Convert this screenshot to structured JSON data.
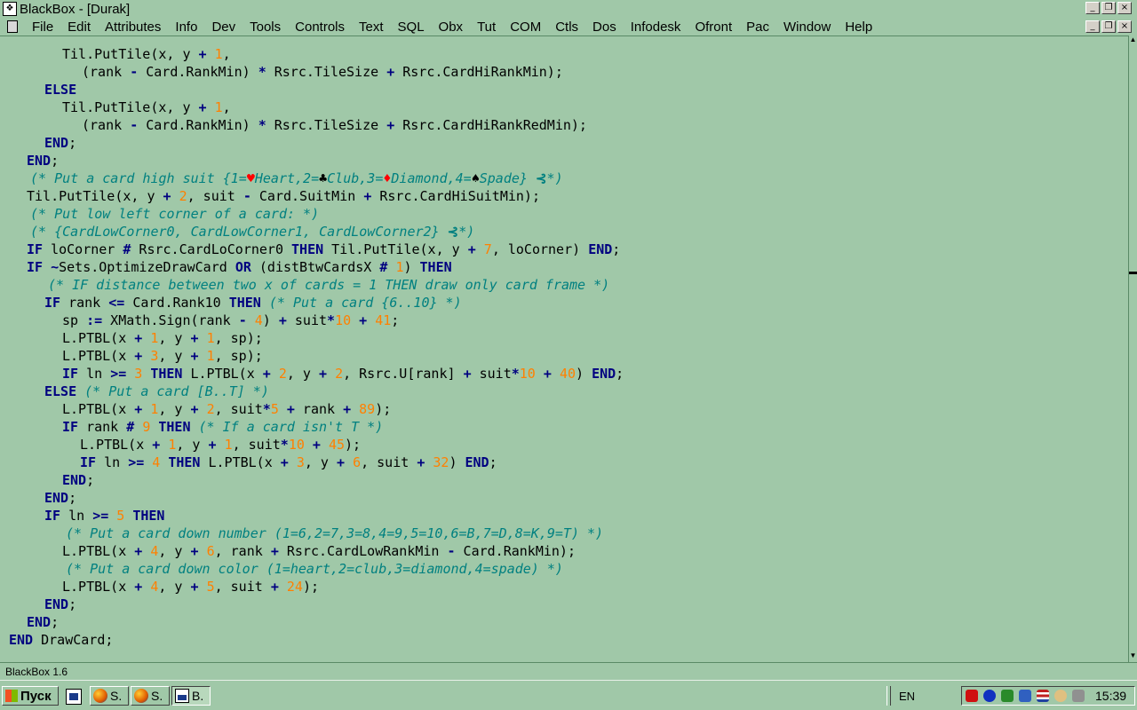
{
  "window": {
    "title": "BlackBox - [Durak]",
    "app_icon_glyph": "❖",
    "outer_controls": [
      "_",
      "❐",
      "×"
    ],
    "doc_controls": [
      "_",
      "❐",
      "×"
    ]
  },
  "menu": [
    "File",
    "Edit",
    "Attributes",
    "Info",
    "Dev",
    "Tools",
    "Controls",
    "Text",
    "SQL",
    "Obx",
    "Tut",
    "COM",
    "Ctls",
    "Dos",
    "Infodesk",
    "Ofront",
    "Pac",
    "Window",
    "Help"
  ],
  "code_lines": [
    {
      "indent": 70,
      "tokens": [
        {
          "t": "Til.PutTile(x, y "
        },
        {
          "t": "+",
          "c": "kw"
        },
        {
          "t": " "
        },
        {
          "t": "1",
          "c": "num"
        },
        {
          "t": ","
        }
      ]
    },
    {
      "indent": 92,
      "tokens": [
        {
          "t": "(rank "
        },
        {
          "t": "-",
          "c": "kw"
        },
        {
          "t": " Card.RankMin) "
        },
        {
          "t": "*",
          "c": "kw"
        },
        {
          "t": " Rsrc.TileSize "
        },
        {
          "t": "+",
          "c": "kw"
        },
        {
          "t": " Rsrc.CardHiRankMin);"
        }
      ]
    },
    {
      "indent": 50,
      "tokens": [
        {
          "t": "ELSE",
          "c": "kw"
        }
      ]
    },
    {
      "indent": 70,
      "tokens": [
        {
          "t": "Til.PutTile(x, y "
        },
        {
          "t": "+",
          "c": "kw"
        },
        {
          "t": " "
        },
        {
          "t": "1",
          "c": "num"
        },
        {
          "t": ","
        }
      ]
    },
    {
      "indent": 92,
      "tokens": [
        {
          "t": "(rank "
        },
        {
          "t": "-",
          "c": "kw"
        },
        {
          "t": " Card.RankMin) "
        },
        {
          "t": "*",
          "c": "kw"
        },
        {
          "t": " Rsrc.TileSize "
        },
        {
          "t": "+",
          "c": "kw"
        },
        {
          "t": " Rsrc.CardHiRankRedMin);"
        }
      ]
    },
    {
      "indent": 50,
      "tokens": [
        {
          "t": "END",
          "c": "kw"
        },
        {
          "t": ";"
        }
      ]
    },
    {
      "indent": 30,
      "tokens": [
        {
          "t": "END",
          "c": "kw"
        },
        {
          "t": ";"
        }
      ]
    },
    {
      "indent": 34,
      "tokens": [
        {
          "t": "(* Put a card high suit {1=",
          "c": "cm"
        },
        {
          "t": "♥",
          "c": "red"
        },
        {
          "t": "Heart,2=",
          "c": "cm"
        },
        {
          "t": "♣",
          "c": "black"
        },
        {
          "t": "Club,3=",
          "c": "cm"
        },
        {
          "t": "♦",
          "c": "red"
        },
        {
          "t": "Diamond,4=",
          "c": "cm"
        },
        {
          "t": "♠",
          "c": "black"
        },
        {
          "t": "Spade} ",
          "c": "cm"
        },
        {
          "t": "⊰",
          "c": "fold"
        },
        {
          "t": "*)",
          "c": "cm"
        }
      ]
    },
    {
      "indent": 30,
      "tokens": [
        {
          "t": "Til.PutTile(x, y "
        },
        {
          "t": "+",
          "c": "kw"
        },
        {
          "t": " "
        },
        {
          "t": "2",
          "c": "num"
        },
        {
          "t": ", suit "
        },
        {
          "t": "-",
          "c": "kw"
        },
        {
          "t": " Card.SuitMin "
        },
        {
          "t": "+",
          "c": "kw"
        },
        {
          "t": " Rsrc.CardHiSuitMin);"
        }
      ]
    },
    {
      "indent": 34,
      "tokens": [
        {
          "t": "(* Put low left corner of a card: *)",
          "c": "cm"
        }
      ]
    },
    {
      "indent": 34,
      "tokens": [
        {
          "t": "(* {CardLowCorner0, CardLowCorner1, CardLowCorner2} ",
          "c": "cm"
        },
        {
          "t": "⊰",
          "c": "fold"
        },
        {
          "t": "*)",
          "c": "cm"
        }
      ]
    },
    {
      "indent": 30,
      "tokens": [
        {
          "t": "IF",
          "c": "kw"
        },
        {
          "t": " loCorner "
        },
        {
          "t": "#",
          "c": "kw"
        },
        {
          "t": " Rsrc.CardLoCorner0 "
        },
        {
          "t": "THEN",
          "c": "kw"
        },
        {
          "t": " Til.PutTile(x, y "
        },
        {
          "t": "+",
          "c": "kw"
        },
        {
          "t": " "
        },
        {
          "t": "7",
          "c": "num"
        },
        {
          "t": ", loCorner) "
        },
        {
          "t": "END",
          "c": "kw"
        },
        {
          "t": ";"
        }
      ]
    },
    {
      "indent": 30,
      "tokens": [
        {
          "t": "IF",
          "c": "kw"
        },
        {
          "t": " "
        },
        {
          "t": "~",
          "c": "kw"
        },
        {
          "t": "Sets.OptimizeDrawCard "
        },
        {
          "t": "OR",
          "c": "kw"
        },
        {
          "t": " (distBtwCardsX "
        },
        {
          "t": "#",
          "c": "kw"
        },
        {
          "t": " "
        },
        {
          "t": "1",
          "c": "num"
        },
        {
          "t": ") "
        },
        {
          "t": "THEN",
          "c": "kw"
        }
      ]
    },
    {
      "indent": 54,
      "tokens": [
        {
          "t": "(* IF distance between two x of cards = 1 THEN draw only card frame *)",
          "c": "cm"
        }
      ]
    },
    {
      "indent": 50,
      "tokens": [
        {
          "t": "IF",
          "c": "kw"
        },
        {
          "t": " rank "
        },
        {
          "t": "<=",
          "c": "kw"
        },
        {
          "t": " Card.Rank10 "
        },
        {
          "t": "THEN",
          "c": "kw"
        },
        {
          "t": " "
        },
        {
          "t": "(* Put a card {6..10} *)",
          "c": "cm"
        }
      ]
    },
    {
      "indent": 70,
      "tokens": [
        {
          "t": "sp "
        },
        {
          "t": ":=",
          "c": "kw"
        },
        {
          "t": " XMath.Sign(rank "
        },
        {
          "t": "-",
          "c": "kw"
        },
        {
          "t": " "
        },
        {
          "t": "4",
          "c": "num"
        },
        {
          "t": ") "
        },
        {
          "t": "+",
          "c": "kw"
        },
        {
          "t": " suit"
        },
        {
          "t": "*",
          "c": "kw"
        },
        {
          "t": "10",
          "c": "num"
        },
        {
          "t": " "
        },
        {
          "t": "+",
          "c": "kw"
        },
        {
          "t": " "
        },
        {
          "t": "41",
          "c": "num"
        },
        {
          "t": ";"
        }
      ]
    },
    {
      "indent": 70,
      "tokens": [
        {
          "t": "L.PTBL(x "
        },
        {
          "t": "+",
          "c": "kw"
        },
        {
          "t": " "
        },
        {
          "t": "1",
          "c": "num"
        },
        {
          "t": ", y "
        },
        {
          "t": "+",
          "c": "kw"
        },
        {
          "t": " "
        },
        {
          "t": "1",
          "c": "num"
        },
        {
          "t": ", sp);"
        }
      ]
    },
    {
      "indent": 70,
      "tokens": [
        {
          "t": "L.PTBL(x "
        },
        {
          "t": "+",
          "c": "kw"
        },
        {
          "t": " "
        },
        {
          "t": "3",
          "c": "num"
        },
        {
          "t": ", y "
        },
        {
          "t": "+",
          "c": "kw"
        },
        {
          "t": " "
        },
        {
          "t": "1",
          "c": "num"
        },
        {
          "t": ", sp);"
        }
      ]
    },
    {
      "indent": 70,
      "tokens": [
        {
          "t": "IF",
          "c": "kw"
        },
        {
          "t": " ln "
        },
        {
          "t": ">=",
          "c": "kw"
        },
        {
          "t": " "
        },
        {
          "t": "3",
          "c": "num"
        },
        {
          "t": " "
        },
        {
          "t": "THEN",
          "c": "kw"
        },
        {
          "t": " L.PTBL(x "
        },
        {
          "t": "+",
          "c": "kw"
        },
        {
          "t": " "
        },
        {
          "t": "2",
          "c": "num"
        },
        {
          "t": ", y "
        },
        {
          "t": "+",
          "c": "kw"
        },
        {
          "t": " "
        },
        {
          "t": "2",
          "c": "num"
        },
        {
          "t": ", Rsrc.U[rank] "
        },
        {
          "t": "+",
          "c": "kw"
        },
        {
          "t": " suit"
        },
        {
          "t": "*",
          "c": "kw"
        },
        {
          "t": "10",
          "c": "num"
        },
        {
          "t": " "
        },
        {
          "t": "+",
          "c": "kw"
        },
        {
          "t": " "
        },
        {
          "t": "40",
          "c": "num"
        },
        {
          "t": ") "
        },
        {
          "t": "END",
          "c": "kw"
        },
        {
          "t": ";"
        }
      ]
    },
    {
      "indent": 50,
      "tokens": [
        {
          "t": "ELSE",
          "c": "kw"
        },
        {
          "t": " "
        },
        {
          "t": "(* Put a card [B..T] *)",
          "c": "cm"
        }
      ]
    },
    {
      "indent": 70,
      "tokens": [
        {
          "t": "L.PTBL(x "
        },
        {
          "t": "+",
          "c": "kw"
        },
        {
          "t": " "
        },
        {
          "t": "1",
          "c": "num"
        },
        {
          "t": ", y "
        },
        {
          "t": "+",
          "c": "kw"
        },
        {
          "t": " "
        },
        {
          "t": "2",
          "c": "num"
        },
        {
          "t": ", suit"
        },
        {
          "t": "*",
          "c": "kw"
        },
        {
          "t": "5",
          "c": "num"
        },
        {
          "t": " "
        },
        {
          "t": "+",
          "c": "kw"
        },
        {
          "t": " rank "
        },
        {
          "t": "+",
          "c": "kw"
        },
        {
          "t": " "
        },
        {
          "t": "89",
          "c": "num"
        },
        {
          "t": ");"
        }
      ]
    },
    {
      "indent": 70,
      "tokens": [
        {
          "t": "IF",
          "c": "kw"
        },
        {
          "t": " rank "
        },
        {
          "t": "#",
          "c": "kw"
        },
        {
          "t": " "
        },
        {
          "t": "9",
          "c": "num"
        },
        {
          "t": " "
        },
        {
          "t": "THEN",
          "c": "kw"
        },
        {
          "t": " "
        },
        {
          "t": "(* If a card isn't T *)",
          "c": "cm"
        }
      ]
    },
    {
      "indent": 90,
      "tokens": [
        {
          "t": "L.PTBL(x "
        },
        {
          "t": "+",
          "c": "kw"
        },
        {
          "t": " "
        },
        {
          "t": "1",
          "c": "num"
        },
        {
          "t": ", y "
        },
        {
          "t": "+",
          "c": "kw"
        },
        {
          "t": " "
        },
        {
          "t": "1",
          "c": "num"
        },
        {
          "t": ", suit"
        },
        {
          "t": "*",
          "c": "kw"
        },
        {
          "t": "10",
          "c": "num"
        },
        {
          "t": " "
        },
        {
          "t": "+",
          "c": "kw"
        },
        {
          "t": " "
        },
        {
          "t": "45",
          "c": "num"
        },
        {
          "t": ");"
        }
      ]
    },
    {
      "indent": 90,
      "tokens": [
        {
          "t": "IF",
          "c": "kw"
        },
        {
          "t": " ln "
        },
        {
          "t": ">=",
          "c": "kw"
        },
        {
          "t": " "
        },
        {
          "t": "4",
          "c": "num"
        },
        {
          "t": " "
        },
        {
          "t": "THEN",
          "c": "kw"
        },
        {
          "t": " L.PTBL(x "
        },
        {
          "t": "+",
          "c": "kw"
        },
        {
          "t": " "
        },
        {
          "t": "3",
          "c": "num"
        },
        {
          "t": ", y "
        },
        {
          "t": "+",
          "c": "kw"
        },
        {
          "t": " "
        },
        {
          "t": "6",
          "c": "num"
        },
        {
          "t": ", suit "
        },
        {
          "t": "+",
          "c": "kw"
        },
        {
          "t": " "
        },
        {
          "t": "32",
          "c": "num"
        },
        {
          "t": ") "
        },
        {
          "t": "END",
          "c": "kw"
        },
        {
          "t": ";"
        }
      ]
    },
    {
      "indent": 70,
      "tokens": [
        {
          "t": "END",
          "c": "kw"
        },
        {
          "t": ";"
        }
      ]
    },
    {
      "indent": 50,
      "tokens": [
        {
          "t": "END",
          "c": "kw"
        },
        {
          "t": ";"
        }
      ]
    },
    {
      "indent": 50,
      "tokens": [
        {
          "t": "IF",
          "c": "kw"
        },
        {
          "t": " ln "
        },
        {
          "t": ">=",
          "c": "kw"
        },
        {
          "t": " "
        },
        {
          "t": "5",
          "c": "num"
        },
        {
          "t": " "
        },
        {
          "t": "THEN",
          "c": "kw"
        }
      ]
    },
    {
      "indent": 74,
      "tokens": [
        {
          "t": "(* Put a card down number (1=6,2=7,3=8,4=9,5=10,6=B,7=D,8=K,9=T) *)",
          "c": "cm"
        }
      ]
    },
    {
      "indent": 70,
      "tokens": [
        {
          "t": "L.PTBL(x "
        },
        {
          "t": "+",
          "c": "kw"
        },
        {
          "t": " "
        },
        {
          "t": "4",
          "c": "num"
        },
        {
          "t": ", y "
        },
        {
          "t": "+",
          "c": "kw"
        },
        {
          "t": " "
        },
        {
          "t": "6",
          "c": "num"
        },
        {
          "t": ", rank "
        },
        {
          "t": "+",
          "c": "kw"
        },
        {
          "t": " Rsrc.CardLowRankMin "
        },
        {
          "t": "-",
          "c": "kw"
        },
        {
          "t": " Card.RankMin);"
        }
      ]
    },
    {
      "indent": 74,
      "tokens": [
        {
          "t": "(* Put a card down color (1=heart,2=club,3=diamond,4=spade) *)",
          "c": "cm"
        }
      ]
    },
    {
      "indent": 70,
      "tokens": [
        {
          "t": "L.PTBL(x "
        },
        {
          "t": "+",
          "c": "kw"
        },
        {
          "t": " "
        },
        {
          "t": "4",
          "c": "num"
        },
        {
          "t": ", y "
        },
        {
          "t": "+",
          "c": "kw"
        },
        {
          "t": " "
        },
        {
          "t": "5",
          "c": "num"
        },
        {
          "t": ", suit "
        },
        {
          "t": "+",
          "c": "kw"
        },
        {
          "t": " "
        },
        {
          "t": "24",
          "c": "num"
        },
        {
          "t": ");"
        }
      ]
    },
    {
      "indent": 50,
      "tokens": [
        {
          "t": "END",
          "c": "kw"
        },
        {
          "t": ";"
        }
      ]
    },
    {
      "indent": 30,
      "tokens": [
        {
          "t": "END",
          "c": "kw"
        },
        {
          "t": ";"
        }
      ]
    },
    {
      "indent": 10,
      "tokens": [
        {
          "t": "END",
          "c": "kw"
        },
        {
          "t": " DrawCard;"
        }
      ]
    }
  ],
  "status": {
    "text": "BlackBox 1.6"
  },
  "taskbar": {
    "start_label": "Пуск",
    "buttons": [
      {
        "label": "S.",
        "icon": "firefox-icon"
      },
      {
        "label": "S.",
        "icon": "firefox-icon"
      },
      {
        "label": "B.",
        "icon": "blackbox-icon",
        "active": true
      }
    ],
    "language": "EN",
    "clock": "15:39"
  },
  "colors": {
    "background": "#a0c8a8",
    "keyword": "#000080",
    "number": "#ff8000",
    "comment": "#008080",
    "suit_red": "#ff0000"
  }
}
